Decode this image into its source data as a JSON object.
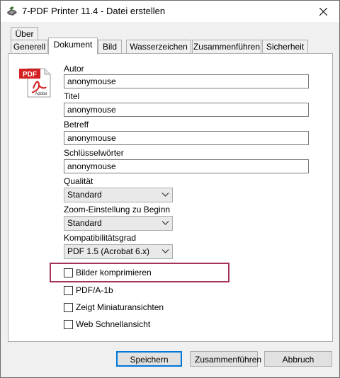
{
  "window": {
    "title": "7-PDF Printer 11.4 - Datei erstellen"
  },
  "tabs": {
    "row1": [
      {
        "label": "Über"
      }
    ],
    "row2": [
      {
        "label": "Generell"
      },
      {
        "label": "Dokument",
        "active": true
      },
      {
        "label": "Bild"
      },
      {
        "label": "Wasserzeichen"
      },
      {
        "label": "Zusammenführen"
      },
      {
        "label": "Sicherheit"
      }
    ]
  },
  "fields": {
    "autor": {
      "label": "Autor",
      "value": "anonymouse"
    },
    "titel": {
      "label": "Titel",
      "value": "anonymouse"
    },
    "betreff": {
      "label": "Betreff",
      "value": "anonymouse"
    },
    "schluesselwoerter": {
      "label": "Schlüsselwörter",
      "value": "anonymouse"
    }
  },
  "selects": {
    "qualitaet": {
      "label": "Qualität",
      "value": "Standard"
    },
    "zoom": {
      "label": "Zoom-Einstellung zu Beginn",
      "value": "Standard"
    },
    "kompatibilitaet": {
      "label": "Kompatibilitätsgrad",
      "value": "PDF 1.5 (Acrobat 6.x)"
    }
  },
  "checkboxes": [
    {
      "label": "Bilder komprimieren",
      "checked": false
    },
    {
      "label": "PDF/A-1b",
      "checked": false
    },
    {
      "label": "Zeigt Miniaturansichten",
      "checked": false
    },
    {
      "label": "Web Schnellansicht",
      "checked": false
    }
  ],
  "buttons": {
    "save": "Speichern",
    "merge": "Zusammenführen",
    "cancel": "Abbruch"
  },
  "icons": {
    "pdf_icon_text": "PDF",
    "pdf_icon_brand": "Adobe"
  },
  "colors": {
    "highlight": "#a4325f",
    "pdf_red": "#d42020",
    "primary_border": "#0078d7"
  }
}
